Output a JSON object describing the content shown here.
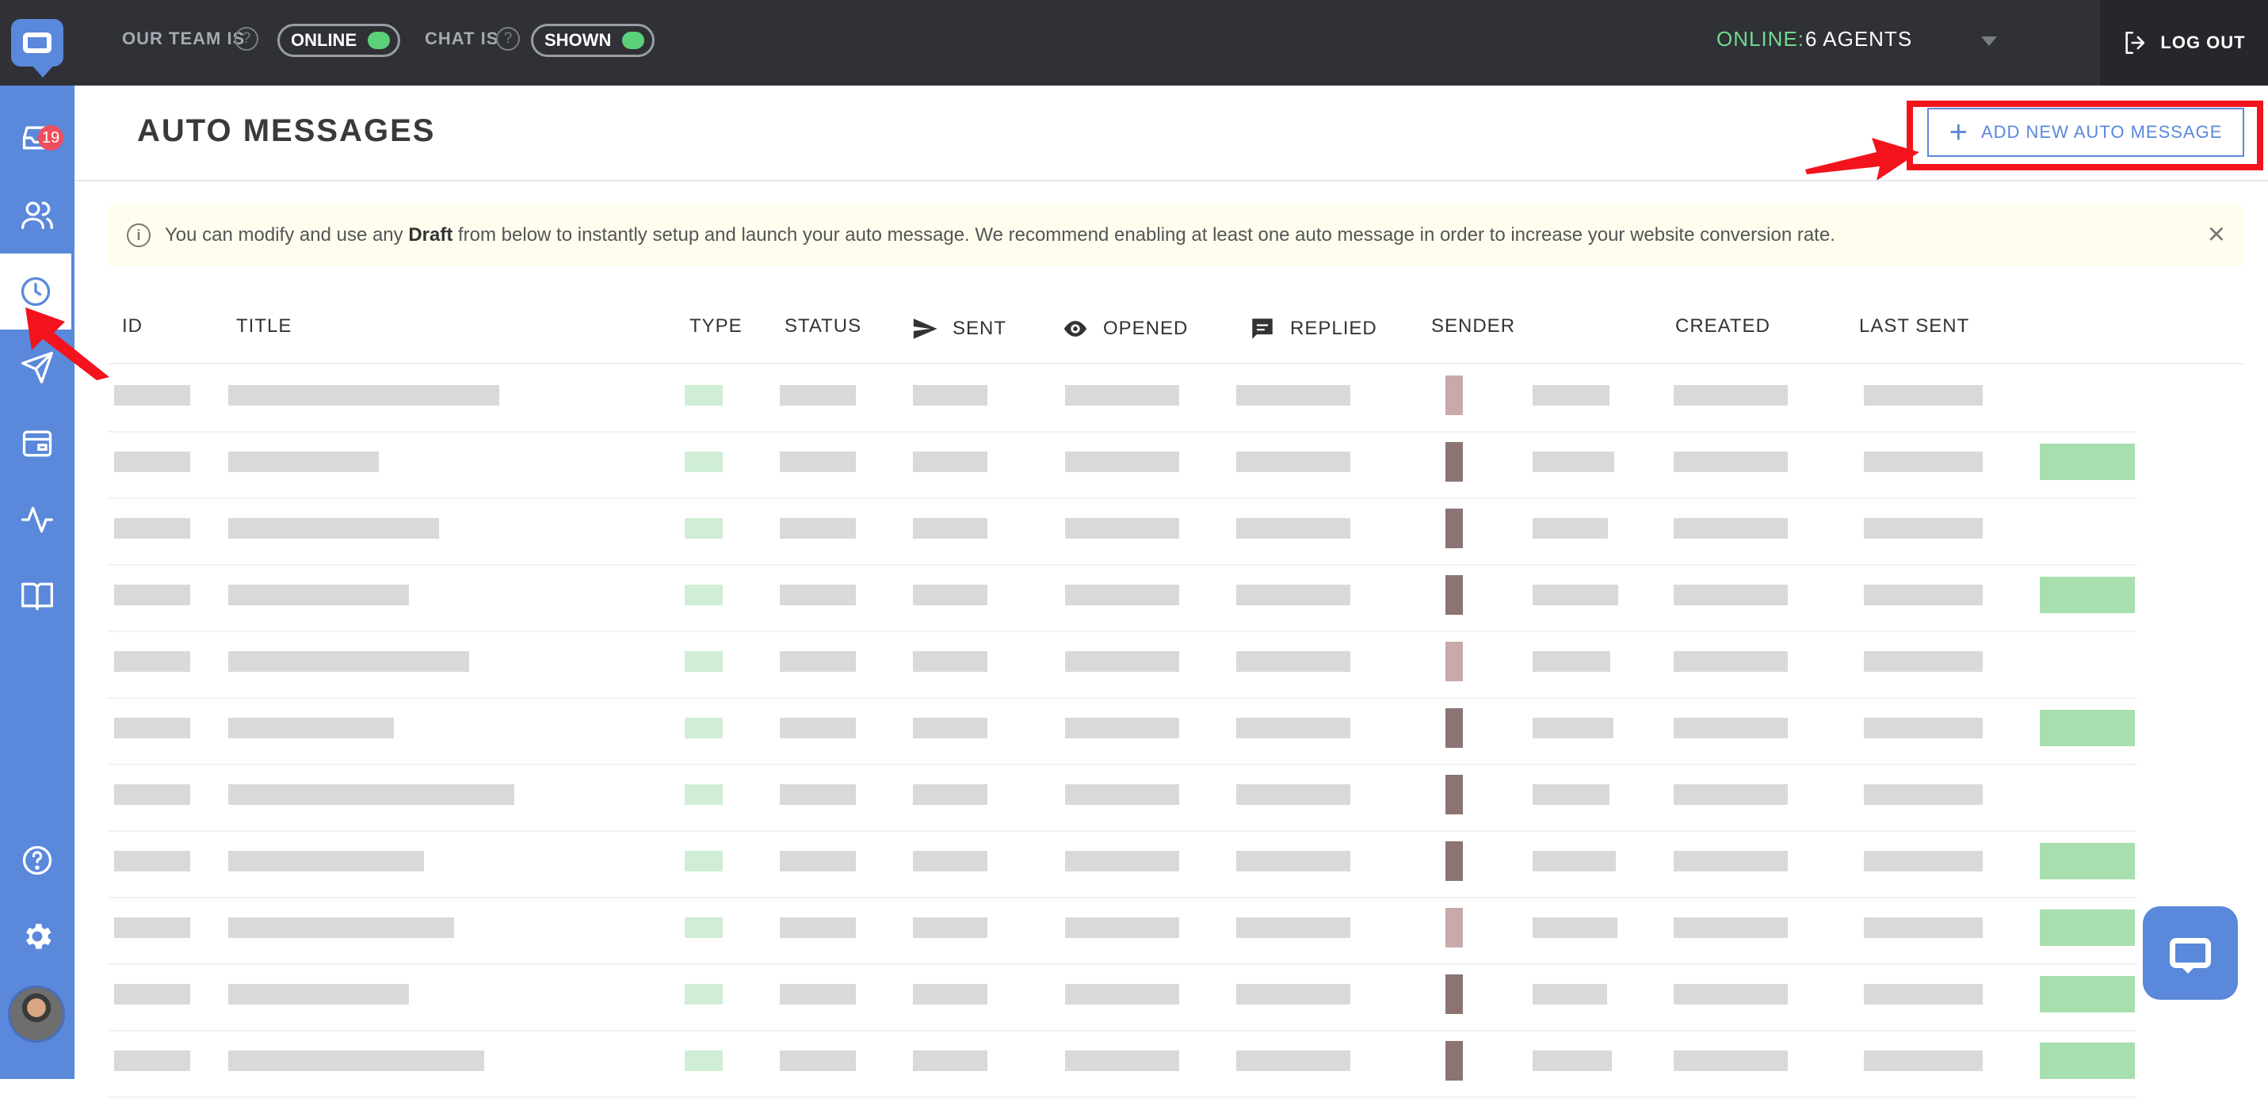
{
  "app": {
    "brand_color": "#5a88db",
    "sidebar": {
      "items": [
        {
          "name": "inbox-icon",
          "badge": "19"
        },
        {
          "name": "users-icon"
        },
        {
          "name": "clock-icon",
          "active": true
        },
        {
          "name": "send-icon"
        },
        {
          "name": "widget-icon"
        },
        {
          "name": "activity-icon"
        },
        {
          "name": "book-icon"
        },
        {
          "name": "help-icon"
        },
        {
          "name": "gear-icon"
        }
      ]
    }
  },
  "topbar": {
    "team_label": "OUR TEAM IS",
    "team_status": "ONLINE",
    "chat_label": "CHAT IS",
    "chat_status": "SHOWN",
    "online_label": "ONLINE:",
    "online_value": "6 AGENTS",
    "logout_label": "LOG OUT",
    "toggle_color": "#5bd17a"
  },
  "header": {
    "title": "AUTO MESSAGES",
    "add_button_label": "ADD NEW AUTO MESSAGE",
    "highlight_color": "#f3131d"
  },
  "notice": {
    "text_before": "You can modify and use any ",
    "text_bold": "Draft",
    "text_after": " from below to instantly setup and launch your auto message. We recommend enabling at least one auto message in order to increase your website conversion rate.",
    "close_label": "×"
  },
  "table": {
    "columns": {
      "id": "ID",
      "title": "TITLE",
      "type": "TYPE",
      "status": "STATUS",
      "sent": "SENT",
      "opened": "OPENED",
      "replied": "REPLIED",
      "sender": "SENDER",
      "created": "CREATED",
      "last_sent": "LAST SENT"
    },
    "row_count": 11,
    "row_content": "pixelated"
  }
}
